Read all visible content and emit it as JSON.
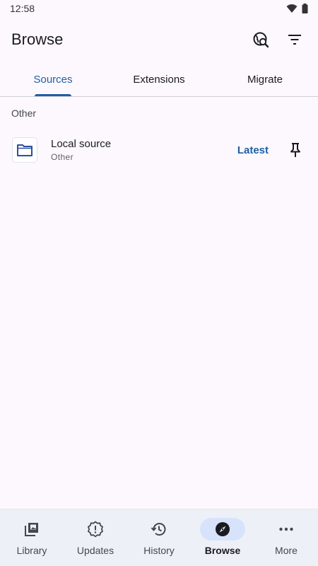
{
  "status_bar": {
    "time": "12:58"
  },
  "top_bar": {
    "title": "Browse"
  },
  "tabs": [
    {
      "label": "Sources",
      "active": true
    },
    {
      "label": "Extensions",
      "active": false
    },
    {
      "label": "Migrate",
      "active": false
    }
  ],
  "section": {
    "header": "Other"
  },
  "source": {
    "name": "Local source",
    "language": "Other",
    "latest_label": "Latest"
  },
  "bottom_nav": [
    {
      "label": "Library",
      "icon": "library-icon",
      "active": false
    },
    {
      "label": "Updates",
      "icon": "updates-icon",
      "active": false
    },
    {
      "label": "History",
      "icon": "history-icon",
      "active": false
    },
    {
      "label": "Browse",
      "icon": "compass-icon",
      "active": true
    },
    {
      "label": "More",
      "icon": "more-icon",
      "active": false
    }
  ],
  "colors": {
    "accent": "#1f5fa6",
    "nav_bg": "#eef0f8",
    "nav_active_pill": "#d6e3fb",
    "background": "#fcf8fd"
  }
}
